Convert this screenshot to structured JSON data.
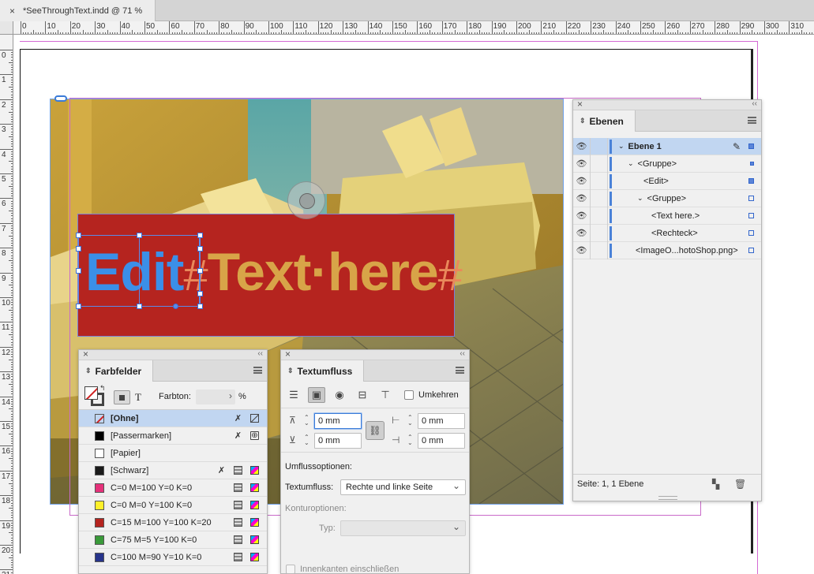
{
  "document": {
    "tab_close": "×",
    "tab_title": "*SeeThroughText.indd @ 71 %"
  },
  "ruler": {
    "h_labels": [
      "0",
      "10",
      "20",
      "30",
      "40",
      "50",
      "60",
      "70",
      "80",
      "90",
      "100",
      "110",
      "120",
      "130",
      "140",
      "150",
      "160",
      "170",
      "180",
      "190",
      "200",
      "210",
      "220",
      "230",
      "240",
      "250",
      "260",
      "270",
      "280",
      "290",
      "300",
      "310"
    ],
    "v_labels": [
      "0",
      "1",
      "2",
      "3",
      "4",
      "5",
      "6",
      "7",
      "8",
      "9",
      "10",
      "11",
      "12",
      "13",
      "14",
      "15",
      "16",
      "17",
      "18",
      "19",
      "20",
      "21"
    ]
  },
  "artwork": {
    "text_edit": "Edit",
    "text_rest": "Text·here",
    "hash1": "#",
    "hash2": "#"
  },
  "layers_panel": {
    "title": "Ebenen",
    "updown": "⇕",
    "rows": [
      {
        "name": "Ebene 1"
      },
      {
        "name": "<Gruppe>"
      },
      {
        "name": "<Edit>"
      },
      {
        "name": "<Gruppe>"
      },
      {
        "name": "<Text here.>"
      },
      {
        "name": "<Rechteck>"
      },
      {
        "name": "<ImageO...hotoShop.png>"
      }
    ],
    "footer": "Seite: 1, 1 Ebene"
  },
  "swatches_panel": {
    "title": "Farbfelder",
    "farbton_label": "Farbton:",
    "percent": "%",
    "text_toggle": "T",
    "rows": [
      {
        "name": "[Ohne]",
        "color": "none"
      },
      {
        "name": "[Passermarken]",
        "color": "#000000"
      },
      {
        "name": "[Papier]",
        "color": "#ffffff"
      },
      {
        "name": "[Schwarz]",
        "color": "#1a1a1a"
      },
      {
        "name": "C=0 M=100 Y=0 K=0",
        "color": "#e5317a"
      },
      {
        "name": "C=0 M=0 Y=100 K=0",
        "color": "#fff02a"
      },
      {
        "name": "C=15 M=100 Y=100 K=20",
        "color": "#b5241f"
      },
      {
        "name": "C=75 M=5 Y=100 K=0",
        "color": "#3a9a3a"
      },
      {
        "name": "C=100 M=90 Y=10 K=0",
        "color": "#27348b"
      }
    ]
  },
  "textwrap_panel": {
    "title": "Textumfluss",
    "invert_label": "Umkehren",
    "offset_top": "0 mm",
    "offset_bottom": "0 mm",
    "offset_left": "0 mm",
    "offset_right": "0 mm",
    "wrap_options_label": "Umflussoptionen:",
    "wrap_to_label": "Textumfluss:",
    "wrap_to_value": "Rechte und linke Seite",
    "contour_label": "Konturoptionen:",
    "type_label": "Typ:",
    "inner_edges_label": "Innenkanten einschließen"
  },
  "colors": {
    "accent": "#3a7bd8",
    "selection": "#c1d6f1",
    "red_box": "#b5241f"
  }
}
